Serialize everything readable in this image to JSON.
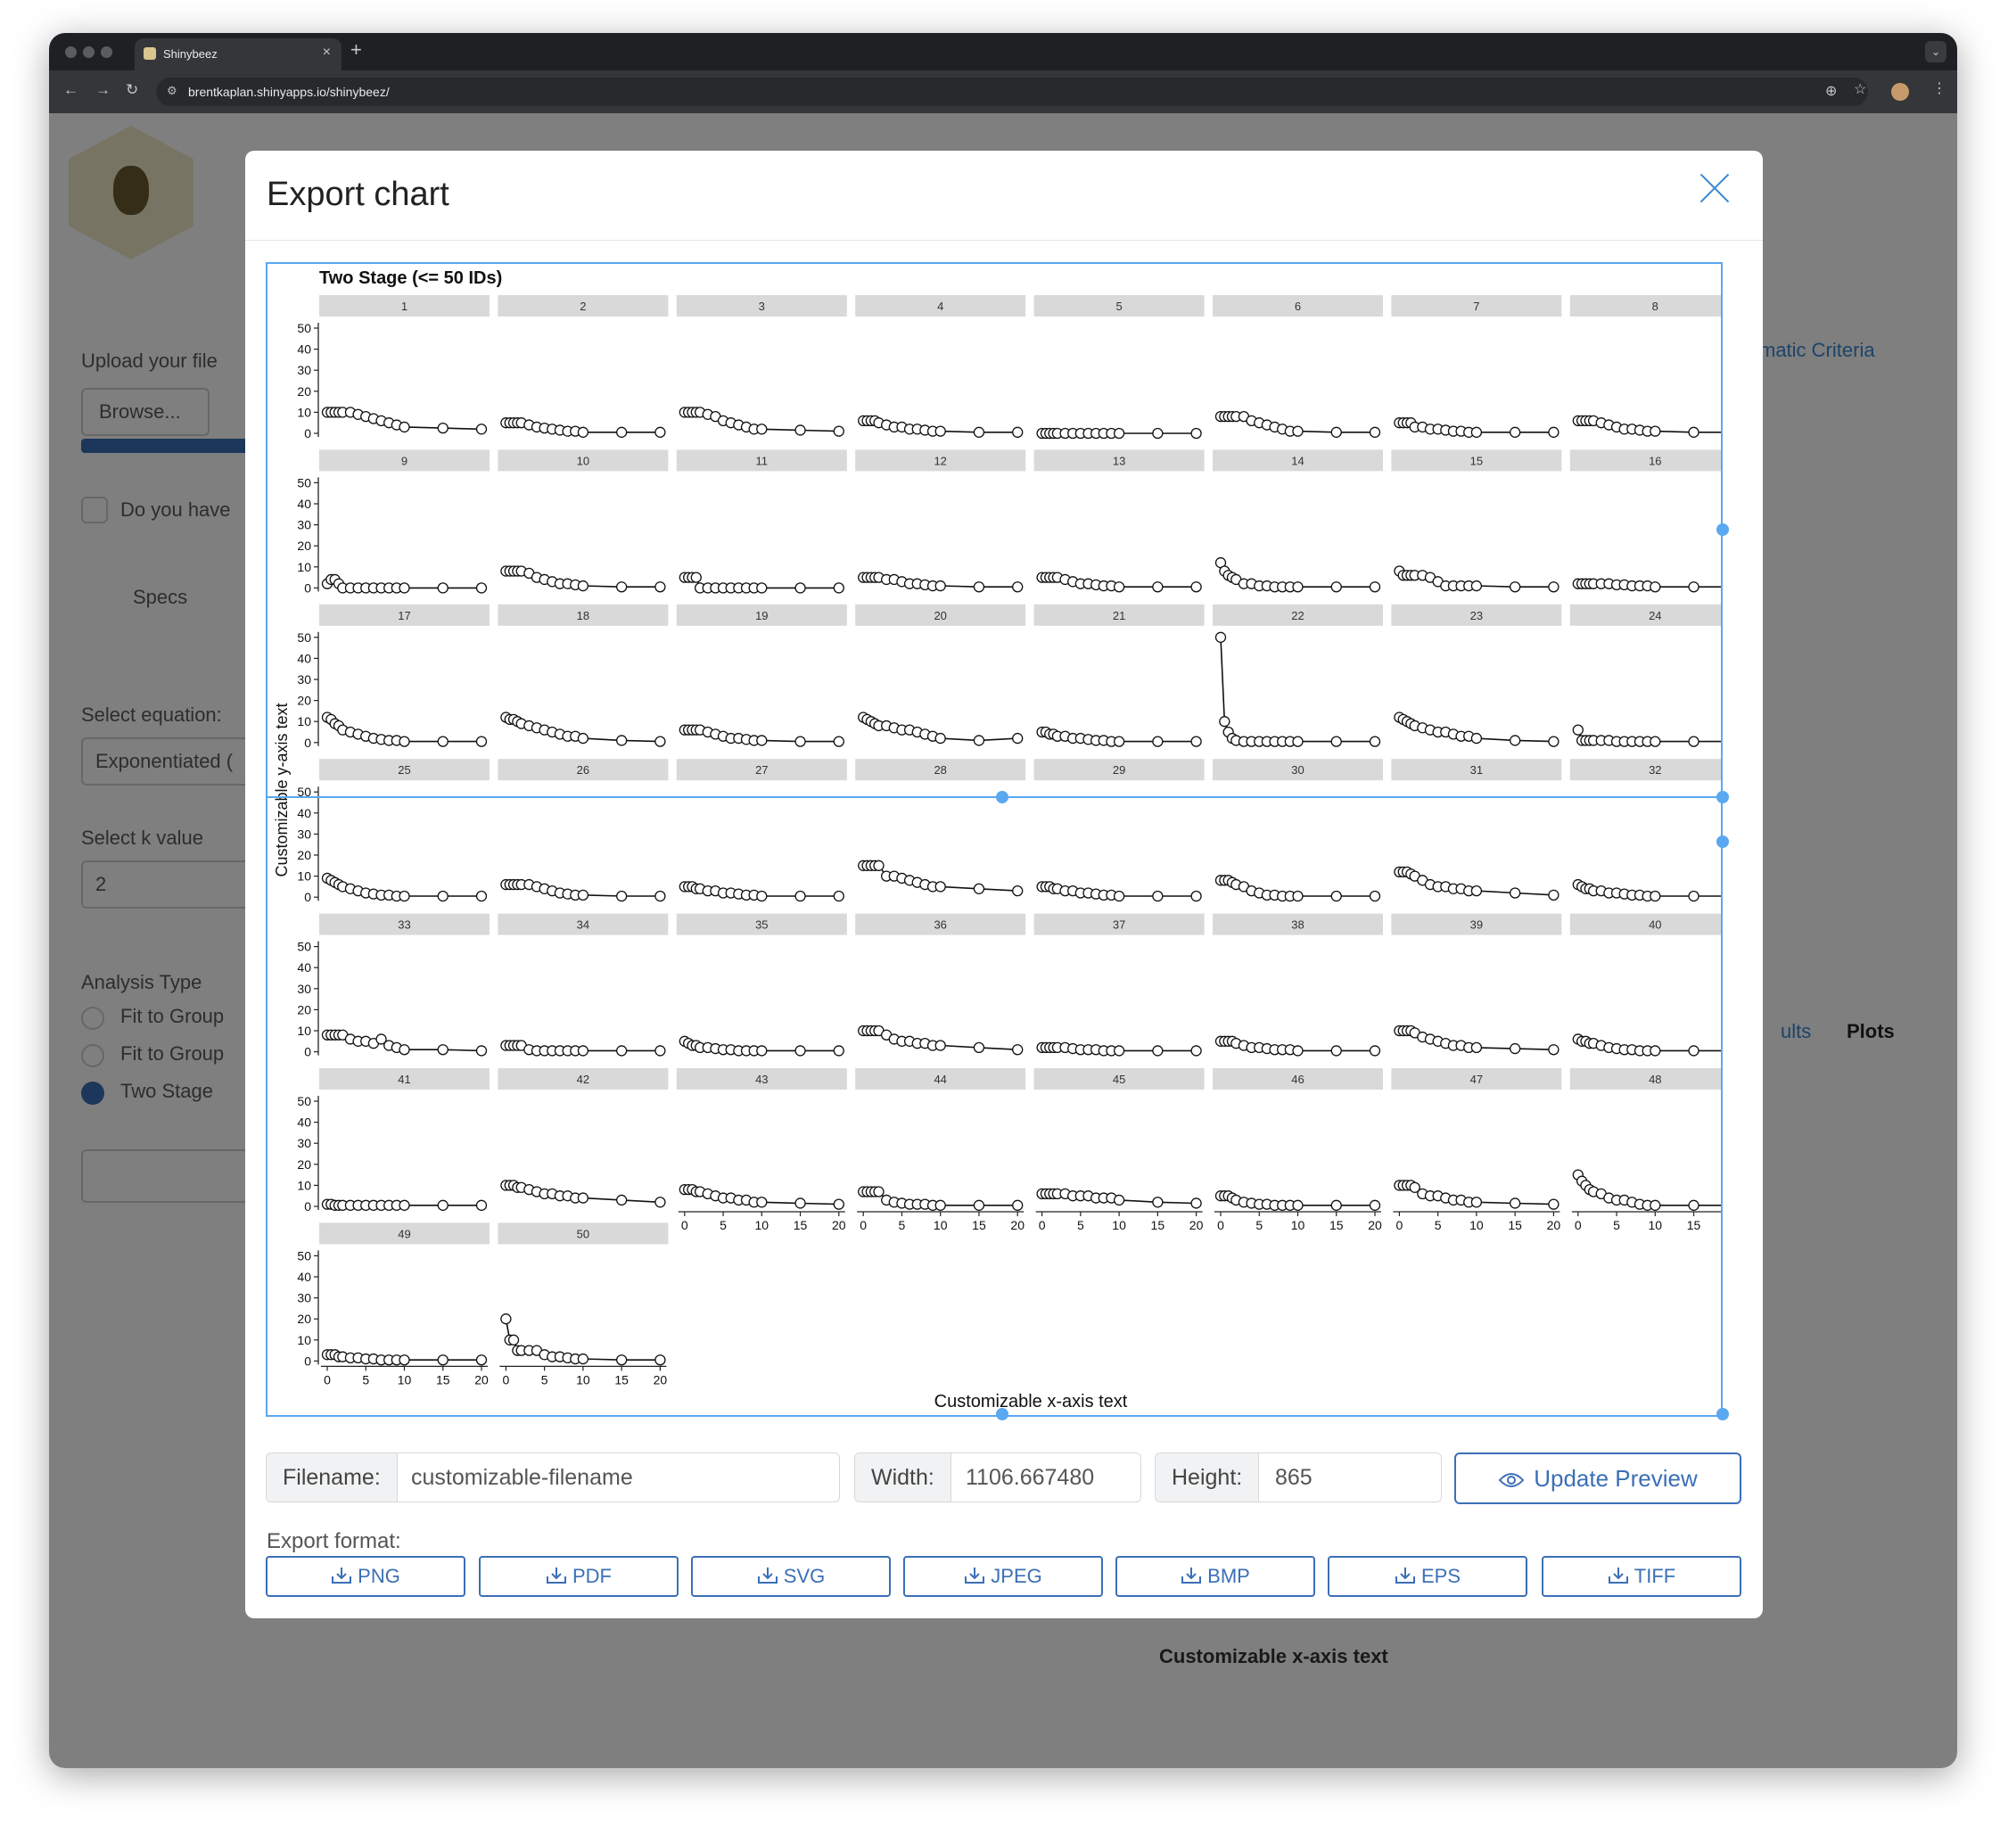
{
  "browser": {
    "tab_title": "Shinybeez",
    "url": "brentkaplan.shinyapps.io/shinybeez/"
  },
  "background_app": {
    "upload_label": "Upload your file",
    "browse_label": "Browse...",
    "question": "Do you have",
    "specs_label": "Specs",
    "select_equation_label": "Select equation:",
    "equation_value": "Exponentiated (",
    "select_k_label": "Select k value",
    "k_value": "2",
    "analysis_type_label": "Analysis Type",
    "analysis_options": [
      "Fit to Group",
      "Fit to Group",
      "Two Stage"
    ],
    "criteria_tab": "matic Criteria",
    "results_tab": "ults",
    "plots_tab": "Plots",
    "bg_xaxis": "Customizable x-axis text"
  },
  "modal": {
    "title": "Export chart",
    "filename_label": "Filename:",
    "filename_value": "customizable-filename",
    "width_label": "Width:",
    "width_value": "1106.667480",
    "height_label": "Height:",
    "height_value": "865",
    "update_button": "Update Preview",
    "format_label": "Export format:",
    "formats": [
      "PNG",
      "PDF",
      "SVG",
      "JPEG",
      "BMP",
      "EPS",
      "TIFF"
    ]
  },
  "chart_data": {
    "type": "scatter",
    "title": "Two Stage (<= 50 IDs)",
    "xlabel": "Customizable x-axis text",
    "ylabel": "Customizable y-axis text",
    "xlim": [
      0,
      20
    ],
    "ylim": [
      0,
      50
    ],
    "x_ticks": [
      0,
      5,
      10,
      15,
      20
    ],
    "y_ticks": [
      0,
      10,
      20,
      30,
      40,
      50
    ],
    "x": [
      0,
      0.5,
      1,
      1.5,
      2,
      3,
      4,
      5,
      6,
      7,
      8,
      9,
      10,
      15,
      20
    ],
    "panels": [
      {
        "id": "1",
        "values": [
          10,
          10,
          10,
          10,
          10,
          10,
          9,
          8,
          7,
          6,
          5,
          4,
          3,
          2.5,
          2
        ]
      },
      {
        "id": "2",
        "values": [
          5,
          5,
          5,
          5,
          5,
          4,
          3,
          2.5,
          2,
          1.5,
          1,
          1,
          0.5,
          0.5,
          0.5
        ]
      },
      {
        "id": "3",
        "values": [
          10,
          10,
          10,
          10,
          10,
          9,
          8,
          6,
          5,
          4,
          3,
          2,
          2,
          1.5,
          1
        ]
      },
      {
        "id": "4",
        "values": [
          6,
          6,
          6,
          6,
          5,
          4,
          3,
          3,
          2,
          2,
          1.5,
          1,
          1,
          0.5,
          0.5
        ]
      },
      {
        "id": "5",
        "values": [
          0,
          0,
          0,
          0,
          0,
          0,
          0,
          0,
          0,
          0,
          0,
          0,
          0,
          0,
          0
        ]
      },
      {
        "id": "6",
        "values": [
          8,
          8,
          8,
          8,
          8,
          8,
          6,
          5,
          4,
          3,
          2,
          1,
          1,
          0.5,
          0.5
        ]
      },
      {
        "id": "7",
        "values": [
          5,
          5,
          5,
          5,
          3,
          3,
          2,
          2,
          1.5,
          1,
          1,
          0.5,
          0.5,
          0.5,
          0.5
        ]
      },
      {
        "id": "8",
        "values": [
          6,
          6,
          6,
          6,
          6,
          5,
          4,
          3,
          2,
          2,
          1.5,
          1,
          1,
          0.5,
          0.5
        ]
      },
      {
        "id": "9",
        "values": [
          2,
          4,
          4,
          2,
          0,
          0,
          0,
          0,
          0,
          0,
          0,
          0,
          0,
          0,
          0
        ]
      },
      {
        "id": "10",
        "values": [
          8,
          8,
          8,
          8,
          8,
          7,
          5,
          4,
          3,
          2,
          2,
          1.5,
          1,
          0.5,
          0.5
        ]
      },
      {
        "id": "11",
        "values": [
          5,
          5,
          5,
          5,
          0,
          0,
          0,
          0,
          0,
          0,
          0,
          0,
          0,
          0,
          0
        ]
      },
      {
        "id": "12",
        "values": [
          5,
          5,
          5,
          5,
          5,
          4,
          4,
          3,
          2,
          2,
          1.5,
          1,
          1,
          0.5,
          0.5
        ]
      },
      {
        "id": "13",
        "values": [
          5,
          5,
          5,
          5,
          5,
          4,
          3,
          2,
          2,
          1.5,
          1,
          1,
          0.5,
          0.5,
          0.5
        ]
      },
      {
        "id": "14",
        "values": [
          12,
          8,
          6,
          5,
          4,
          2,
          2,
          1,
          1,
          0.5,
          0.5,
          0.5,
          0.5,
          0.5,
          0.5
        ]
      },
      {
        "id": "15",
        "values": [
          8,
          6,
          6,
          6,
          6,
          6,
          5,
          3,
          1,
          1,
          1,
          1,
          1,
          0.5,
          0.5
        ]
      },
      {
        "id": "16",
        "values": [
          2,
          2,
          2,
          2,
          2,
          2,
          2,
          1.5,
          1.5,
          1,
          1,
          1,
          0.5,
          0.5,
          0.5
        ]
      },
      {
        "id": "17",
        "values": [
          12,
          11,
          9,
          8,
          6,
          5,
          4,
          3,
          2,
          1.5,
          1,
          1,
          0.5,
          0.5,
          0.5
        ]
      },
      {
        "id": "18",
        "values": [
          12,
          11,
          11,
          10,
          9,
          8,
          7,
          6,
          5,
          4,
          3,
          3,
          2,
          1,
          0.5
        ]
      },
      {
        "id": "19",
        "values": [
          6,
          6,
          6,
          6,
          6,
          5,
          4,
          3,
          2,
          2,
          1.5,
          1,
          1,
          0.5,
          0.5
        ]
      },
      {
        "id": "20",
        "values": [
          12,
          11,
          10,
          9,
          8,
          8,
          7,
          6,
          6,
          5,
          4,
          3,
          2,
          1,
          2
        ]
      },
      {
        "id": "21",
        "values": [
          5,
          5,
          4,
          4,
          3,
          3,
          2,
          2,
          1.5,
          1,
          1,
          0.5,
          0.5,
          0.5,
          0.5
        ]
      },
      {
        "id": "22",
        "values": [
          50,
          10,
          5,
          2,
          1,
          0.5,
          0.5,
          0.5,
          0.5,
          0.5,
          0.5,
          0.5,
          0.5,
          0.5,
          0.5
        ]
      },
      {
        "id": "23",
        "values": [
          12,
          11,
          10,
          9,
          8,
          7,
          6,
          5,
          5,
          4,
          3,
          3,
          2,
          1,
          0.5
        ]
      },
      {
        "id": "24",
        "values": [
          6,
          1,
          1,
          1,
          1,
          1,
          1,
          0.5,
          0.5,
          0.5,
          0.5,
          0.5,
          0.5,
          0.5,
          0.5
        ]
      },
      {
        "id": "25",
        "values": [
          9,
          8,
          7,
          6,
          5,
          4,
          3,
          2,
          1.5,
          1,
          1,
          0.5,
          0.5,
          0.5,
          0.5
        ]
      },
      {
        "id": "26",
        "values": [
          6,
          6,
          6,
          6,
          6,
          6,
          5,
          4,
          3,
          2,
          1.5,
          1,
          1,
          0.5,
          0.5
        ]
      },
      {
        "id": "27",
        "values": [
          5,
          5,
          5,
          4,
          4,
          3,
          3,
          2,
          2,
          1.5,
          1,
          1,
          0.5,
          0.5,
          0.5
        ]
      },
      {
        "id": "28",
        "values": [
          15,
          15,
          15,
          15,
          15,
          10,
          10,
          9,
          8,
          7,
          6,
          5,
          5,
          4,
          3
        ]
      },
      {
        "id": "29",
        "values": [
          5,
          5,
          5,
          4,
          4,
          3,
          3,
          2,
          2,
          1.5,
          1,
          1,
          0.5,
          0.5,
          0.5
        ]
      },
      {
        "id": "30",
        "values": [
          8,
          8,
          8,
          7,
          6,
          5,
          3,
          2,
          1,
          1,
          0.5,
          0.5,
          0.5,
          0.5,
          0.5
        ]
      },
      {
        "id": "31",
        "values": [
          12,
          12,
          12,
          11,
          10,
          8,
          6,
          5,
          5,
          4,
          4,
          3,
          3,
          2,
          1
        ]
      },
      {
        "id": "32",
        "values": [
          6,
          5,
          4,
          4,
          3,
          3,
          2,
          2,
          1.5,
          1,
          1,
          0.5,
          0.5,
          0.5,
          0.5
        ]
      },
      {
        "id": "33",
        "values": [
          8,
          8,
          8,
          8,
          8,
          6,
          5,
          5,
          4,
          6,
          3,
          2,
          1,
          1,
          0.5
        ]
      },
      {
        "id": "34",
        "values": [
          3,
          3,
          3,
          3,
          3,
          1,
          0.5,
          0.5,
          0.5,
          0.5,
          0.5,
          0.5,
          0.5,
          0.5,
          0.5
        ]
      },
      {
        "id": "35",
        "values": [
          5,
          4,
          3,
          3,
          2,
          2,
          1.5,
          1,
          1,
          0.5,
          0.5,
          0.5,
          0.5,
          0.5,
          0.5
        ]
      },
      {
        "id": "36",
        "values": [
          10,
          10,
          10,
          10,
          10,
          8,
          6,
          5,
          5,
          4,
          4,
          3,
          3,
          2,
          1
        ]
      },
      {
        "id": "37",
        "values": [
          2,
          2,
          2,
          2,
          2,
          2,
          1.5,
          1,
          1,
          1,
          0.5,
          0.5,
          0.5,
          0.5,
          0.5
        ]
      },
      {
        "id": "38",
        "values": [
          5,
          5,
          5,
          5,
          4,
          3,
          2,
          2,
          1.5,
          1,
          1,
          1,
          0.5,
          0.5,
          0.5
        ]
      },
      {
        "id": "39",
        "values": [
          10,
          10,
          10,
          10,
          9,
          7,
          6,
          5,
          4,
          3,
          3,
          2,
          2,
          1.5,
          1
        ]
      },
      {
        "id": "40",
        "values": [
          6,
          5,
          5,
          4,
          4,
          3,
          2,
          1.5,
          1,
          1,
          0.5,
          0.5,
          0.5,
          0.5,
          0.5
        ]
      },
      {
        "id": "41",
        "values": [
          1,
          1,
          0.5,
          0.5,
          0.5,
          0.5,
          0.5,
          0.5,
          0.5,
          0.5,
          0.5,
          0.5,
          0.5,
          0.5,
          0.5
        ]
      },
      {
        "id": "42",
        "values": [
          10,
          10,
          10,
          9,
          9,
          8,
          7,
          6,
          6,
          5,
          5,
          4,
          4,
          3,
          2
        ]
      },
      {
        "id": "43",
        "values": [
          8,
          8,
          8,
          7,
          7,
          6,
          5,
          4,
          4,
          3,
          3,
          2,
          2,
          1.5,
          1
        ]
      },
      {
        "id": "44",
        "values": [
          7,
          7,
          7,
          7,
          7,
          3,
          2,
          1.5,
          1,
          1,
          1,
          0.5,
          0.5,
          0.5,
          0.5
        ]
      },
      {
        "id": "45",
        "values": [
          6,
          6,
          6,
          6,
          6,
          6,
          5,
          5,
          5,
          4,
          4,
          4,
          3,
          2,
          1.5
        ]
      },
      {
        "id": "46",
        "values": [
          5,
          5,
          5,
          4,
          3,
          2,
          1.5,
          1,
          1,
          0.5,
          0.5,
          0.5,
          0.5,
          0.5,
          0.5
        ]
      },
      {
        "id": "47",
        "values": [
          10,
          10,
          10,
          10,
          9,
          6,
          5,
          5,
          4,
          3,
          3,
          2,
          2,
          1.5,
          1
        ]
      },
      {
        "id": "48",
        "values": [
          15,
          12,
          10,
          8,
          7,
          6,
          4,
          3,
          3,
          2,
          1,
          0.5,
          0.5,
          0.5,
          0.5
        ]
      },
      {
        "id": "49",
        "values": [
          3,
          3,
          3,
          2,
          2,
          1.5,
          1.5,
          1,
          1,
          0.5,
          0.5,
          0.5,
          0.5,
          0.5,
          0.5
        ]
      },
      {
        "id": "50",
        "values": [
          20,
          10,
          10,
          5,
          5,
          5,
          5,
          3,
          2,
          2,
          1.5,
          1,
          1,
          0.5,
          0.5
        ]
      }
    ]
  }
}
